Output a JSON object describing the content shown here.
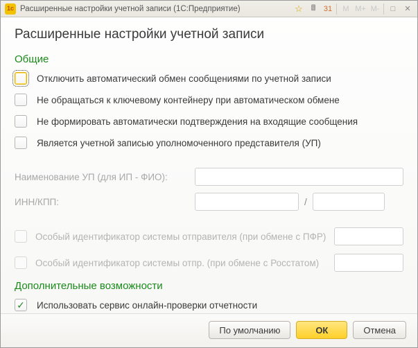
{
  "window": {
    "title": "Расширенные настройки учетной записи  (1С:Предприятие)"
  },
  "page": {
    "title": "Расширенные настройки учетной записи"
  },
  "sections": {
    "general": {
      "title": "Общие",
      "options": {
        "disable_auto_exchange": "Отключить автоматический обмен сообщениями по учетной записи",
        "no_key_container": "Не обращаться к ключевому контейнеру при автоматическом обмене",
        "no_auto_confirm": "Не формировать автоматически подтверждения на входящие сообщения",
        "is_up_account": "Является учетной записью уполномоченного представителя (УП)"
      },
      "fields": {
        "up_name_label": "Наименование УП (для ИП - ФИО):",
        "inn_kpp_label": "ИНН/КПП:"
      },
      "special": {
        "sender_id_pfr": "Особый идентификатор системы отправителя (при обмене с ПФР)",
        "sender_id_rosstat": "Особый идентификатор системы отпр. (при обмене с Росстатом)"
      }
    },
    "additional": {
      "title": "Дополнительные возможности",
      "use_online_check": "Использовать сервис онлайн-проверки отчетности"
    }
  },
  "buttons": {
    "default": "По умолчанию",
    "ok": "ОК",
    "cancel": "Отмена"
  }
}
